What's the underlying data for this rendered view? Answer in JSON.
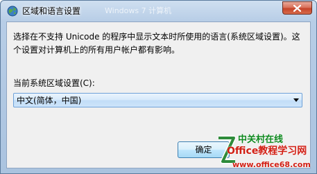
{
  "window": {
    "title": "区域和语言设置",
    "title_ghost": "Windows 7 计算机",
    "icon": "globe-icon",
    "close_icon": "close-icon"
  },
  "dialog": {
    "description": "选择在不支持 Unicode 的程序中显示文本时所使用的语言(系统区域设置)。这个设置对计算机上的所有用户帐户都有影响。",
    "locale_label": "当前系统区域设置(C):",
    "locale_value": "中文(简体，中国)",
    "ok_label": "确定"
  },
  "watermark": {
    "top_text": "中关村在线",
    "mid_text": "Office教程学习网",
    "url_text": "www.office68.com"
  },
  "colors": {
    "title_gradient_top": "#cfdff0",
    "client_bg": "#f0f0f0",
    "close_red": "#c6442a",
    "watermark_red": "#d21f14",
    "watermark_green": "#0f8a20"
  }
}
